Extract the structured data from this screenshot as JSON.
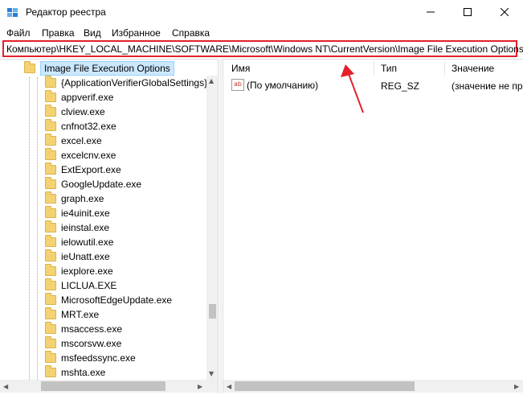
{
  "window": {
    "title": "Редактор реестра",
    "icons": [
      "registry-app-icon",
      "minimize-icon",
      "maximize-icon",
      "close-icon"
    ]
  },
  "menu": [
    "Файл",
    "Правка",
    "Вид",
    "Избранное",
    "Справка"
  ],
  "address": {
    "path": "Компьютер\\HKEY_LOCAL_MACHINE\\SOFTWARE\\Microsoft\\Windows NT\\CurrentVersion\\Image File Execution Options"
  },
  "tree": {
    "selected": "Image File Execution Options",
    "children": [
      "{ApplicationVerifierGlobalSettings}",
      "appverif.exe",
      "clview.exe",
      "cnfnot32.exe",
      "excel.exe",
      "excelcnv.exe",
      "ExtExport.exe",
      "GoogleUpdate.exe",
      "graph.exe",
      "ie4uinit.exe",
      "ieinstal.exe",
      "ielowutil.exe",
      "ieUnatt.exe",
      "iexplore.exe",
      "LICLUA.EXE",
      "MicrosoftEdgeUpdate.exe",
      "MRT.exe",
      "msaccess.exe",
      "mscorsvw.exe",
      "msfeedssync.exe",
      "mshta.exe"
    ]
  },
  "values": {
    "columns": {
      "name": "Имя",
      "type": "Тип",
      "data": "Значение"
    },
    "rows": [
      {
        "name": "(По умолчанию)",
        "type": "REG_SZ",
        "data": "(значение не пр"
      }
    ]
  },
  "annotation": {
    "color": "#e3202a"
  }
}
